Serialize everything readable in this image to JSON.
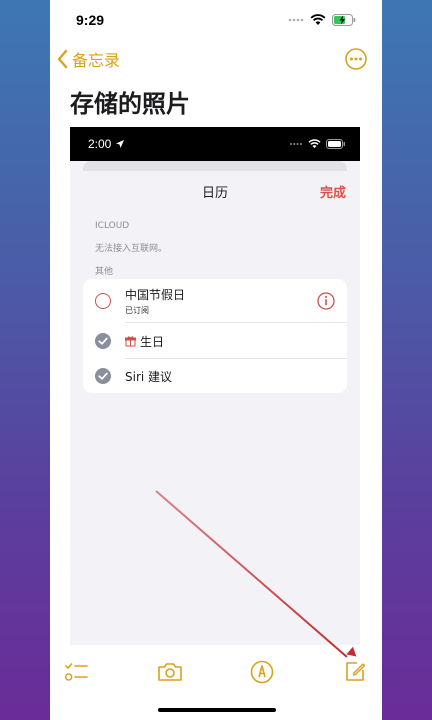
{
  "status": {
    "time": "9:29"
  },
  "nav": {
    "back_label": "备忘录"
  },
  "note": {
    "title": "存储的照片"
  },
  "screenshot": {
    "status_time": "2:00",
    "sheet_title": "日历",
    "done_label": "完成",
    "section_icloud": "ICLOUD",
    "icloud_note": "无法接入互联网。",
    "section_other": "其他",
    "calendars": [
      {
        "title": "中国节假日",
        "subtitle": "已订阅",
        "checked": false
      },
      {
        "title": "生日",
        "checked": true
      },
      {
        "title": "Siri 建议",
        "checked": true
      }
    ]
  },
  "colors": {
    "accent": "#d8a21c",
    "done_red": "#d9534a",
    "check_gray": "#8a8f9e",
    "arrow_red": "#c42d2d"
  },
  "icons": [
    "back-chevron-icon",
    "more-icon",
    "info-icon",
    "gift-icon",
    "checklist-icon",
    "camera-icon",
    "markup-icon",
    "compose-icon"
  ]
}
